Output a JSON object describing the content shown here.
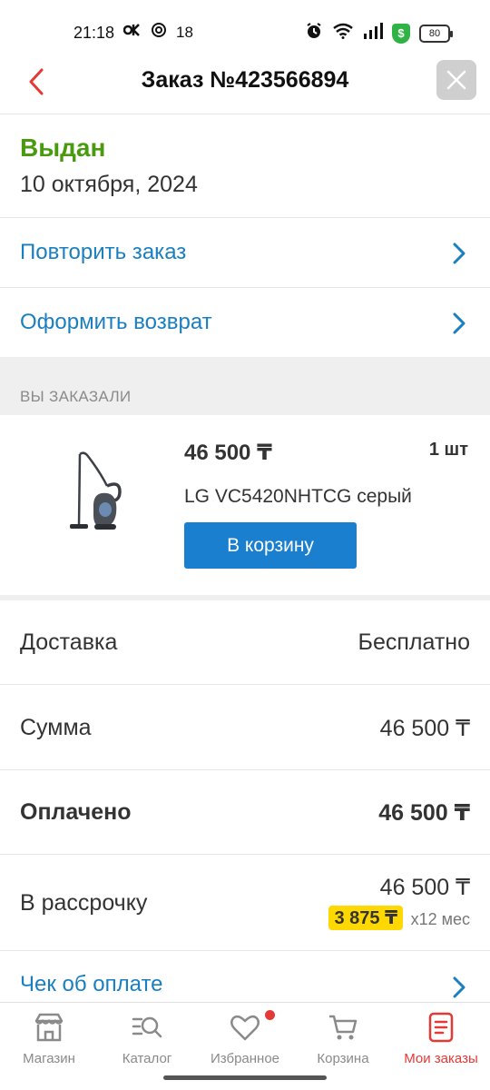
{
  "status_bar": {
    "time": "21:18",
    "left_icons": [
      "ok-icon",
      "at-icon"
    ],
    "left_number": "18",
    "battery": "80",
    "shield_symbol": "$"
  },
  "header": {
    "title": "Заказ №423566894",
    "accent_color": "#e53935"
  },
  "order": {
    "status": "Выдан",
    "status_color": "#4a9a0f",
    "date": "10 октября, 2024"
  },
  "actions": {
    "repeat": "Повторить заказ",
    "return": "Оформить возврат"
  },
  "ordered_section": {
    "title": "ВЫ ЗАКАЗАЛИ"
  },
  "product": {
    "price": "46 500 ₸",
    "quantity": "1 шт",
    "name": "LG VC5420NHTCG серый",
    "cart_button": "В корзину",
    "image_icon": "vacuum-cleaner-icon"
  },
  "summary": {
    "delivery_label": "Доставка",
    "delivery_value": "Бесплатно",
    "sum_label": "Сумма",
    "sum_value": "46 500 ₸",
    "paid_label": "Оплачено",
    "paid_value": "46 500 ₸",
    "installment_label": "В рассрочку",
    "installment_value": "46 500 ₸",
    "installment_monthly": "3 875 ₸",
    "installment_term": "x12 мес"
  },
  "receipt": {
    "label": "Чек об оплате"
  },
  "tabbar": {
    "items": [
      {
        "label": "Магазин",
        "icon": "store-icon"
      },
      {
        "label": "Каталог",
        "icon": "catalog-search-icon"
      },
      {
        "label": "Избранное",
        "icon": "heart-icon"
      },
      {
        "label": "Корзина",
        "icon": "cart-icon"
      },
      {
        "label": "Мои заказы",
        "icon": "orders-icon"
      }
    ],
    "active_index": 4
  }
}
